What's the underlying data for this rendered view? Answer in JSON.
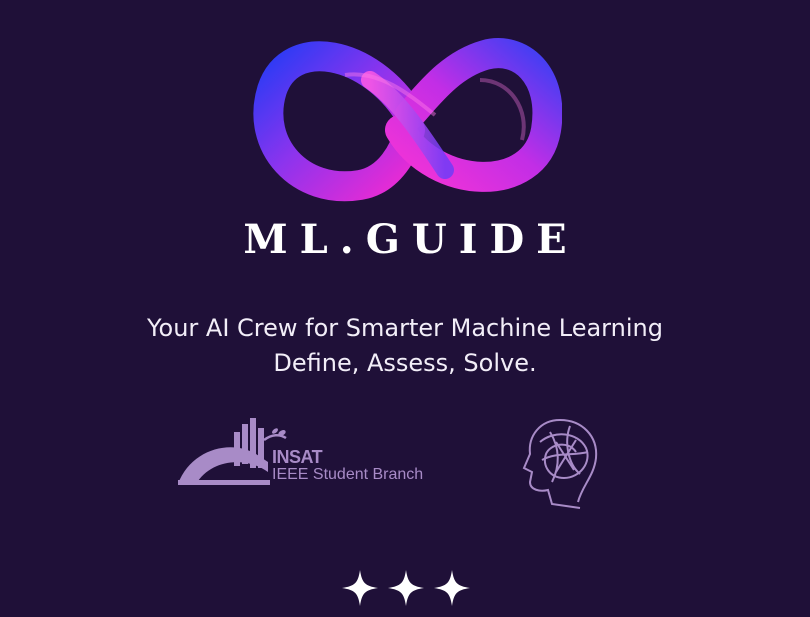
{
  "brand": {
    "logo_icon": "infinity-icon",
    "name": "ML.GUIDE"
  },
  "tagline": {
    "line1": "Your AI Crew for Smarter Machine Learning",
    "line2": "Define, Assess, Solve."
  },
  "partners": {
    "insat": {
      "icon": "insat-bridge-logo-icon",
      "name": "INSAT",
      "subtitle": "IEEE Student Branch"
    },
    "club_icon": "ai-head-icon"
  },
  "decoration": {
    "icon": "sparkles-icon"
  },
  "colors": {
    "background": "#1f1038",
    "accent_magenta": "#e42bd3",
    "accent_blue": "#3b43f2",
    "partner_logo": "#a88bc7"
  }
}
